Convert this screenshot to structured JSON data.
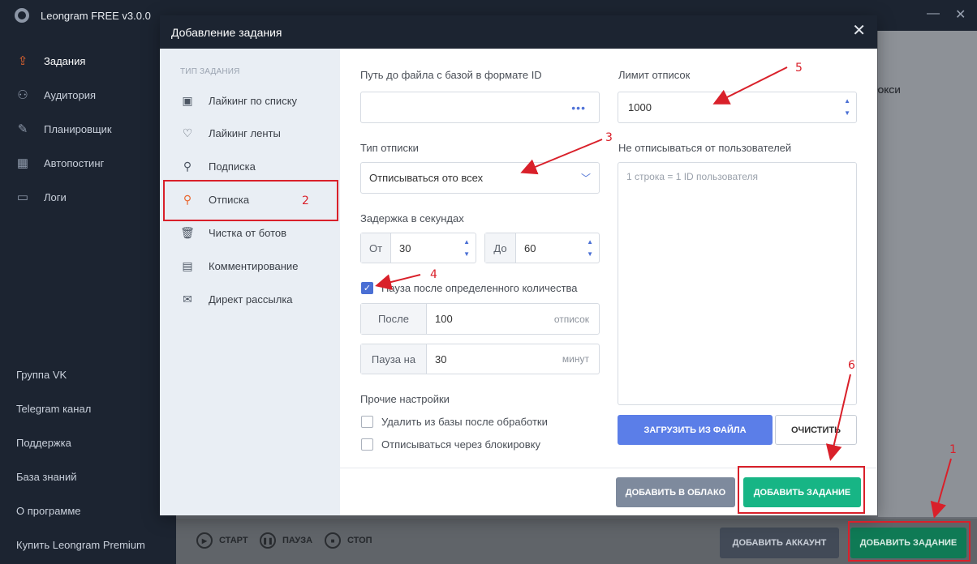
{
  "app": {
    "title": "Leongram FREE v3.0.0"
  },
  "nav": [
    {
      "label": "Задания",
      "icon": "tasks-icon",
      "active": true
    },
    {
      "label": "Аудитория",
      "icon": "users-icon"
    },
    {
      "label": "Планировщик",
      "icon": "edit-icon"
    },
    {
      "label": "Автопостинг",
      "icon": "calendar-icon"
    },
    {
      "label": "Логи",
      "icon": "folder-icon"
    }
  ],
  "side_links": [
    "Группа VK",
    "Telegram канал",
    "Поддержка",
    "База знаний",
    "О программе",
    "Купить Leongram Premium"
  ],
  "background": {
    "proxy_label": "РОКСИ"
  },
  "bottom": {
    "start": "СТАРТ",
    "pause": "ПАУЗА",
    "stop": "СТОП",
    "add_account": "ДОБАВИТЬ АККАУНТ",
    "add_task": "ДОБАВИТЬ ЗАДАНИЕ"
  },
  "modal": {
    "title": "Добавление задания",
    "type_heading": "ТИП ЗАДАНИЯ",
    "types": [
      {
        "label": "Лайкинг по списку",
        "icon": "like-list-icon"
      },
      {
        "label": "Лайкинг ленты",
        "icon": "like-feed-icon"
      },
      {
        "label": "Подписка",
        "icon": "user-plus-icon"
      },
      {
        "label": "Отписка",
        "icon": "user-minus-icon",
        "active": true
      },
      {
        "label": "Чистка от ботов",
        "icon": "trash-icon"
      },
      {
        "label": "Комментирование",
        "icon": "comment-icon"
      },
      {
        "label": "Директ рассылка",
        "icon": "mail-plus-icon"
      }
    ],
    "file_path_label": "Путь до файла с базой в формате ID",
    "file_path_value": "",
    "unsub_type_label": "Тип отписки",
    "unsub_type_value": "Отписываться ото всех",
    "delay_label": "Задержка в секундах",
    "delay_from_label": "От",
    "delay_from_value": "30",
    "delay_to_label": "До",
    "delay_to_value": "60",
    "pause_checkbox_label": "Пауза после определенного количества",
    "pause_checked": true,
    "after_label": "После",
    "after_value": "100",
    "after_suffix": "отписок",
    "pause_for_label": "Пауза на",
    "pause_for_value": "30",
    "pause_for_suffix": "минут",
    "other_settings_label": "Прочие настройки",
    "opt_delete_label": "Удалить из базы после обработки",
    "opt_block_label": "Отписываться через блокировку",
    "limit_label": "Лимит отписок",
    "limit_value": "1000",
    "exclude_label": "Не отписываться от пользователей",
    "exclude_placeholder": "1 строка = 1 ID пользователя",
    "load_file_btn": "ЗАГРУЗИТЬ ИЗ ФАЙЛА",
    "clear_btn": "ОЧИСТИТЬ",
    "add_cloud_btn": "ДОБАВИТЬ В ОБЛАКО",
    "add_task_btn": "ДОБАВИТЬ ЗАДАНИЕ"
  },
  "annotations": [
    "1",
    "2",
    "3",
    "4",
    "5",
    "6"
  ],
  "colors": {
    "annotation": "#d9202a",
    "accent_orange": "#e9672f",
    "primary_blue": "#5b7ee8",
    "green": "#17b585",
    "dark": "#1c2431"
  }
}
